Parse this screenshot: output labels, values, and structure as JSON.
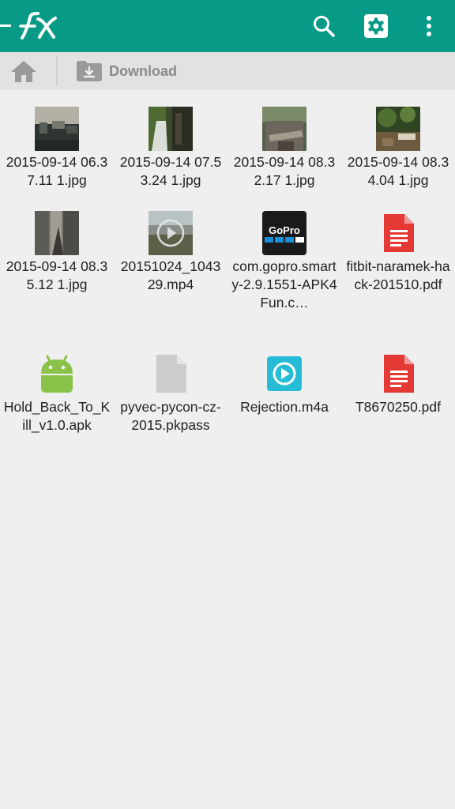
{
  "app": {
    "logo_text": "FX",
    "colors": {
      "appbar": "#079a87",
      "location_bar": "#e2e2e2",
      "background": "#efefef"
    },
    "actions": [
      {
        "name": "search",
        "icon": "search-icon"
      },
      {
        "name": "settings",
        "icon": "gear-icon"
      },
      {
        "name": "more",
        "icon": "more-vert-icon"
      }
    ]
  },
  "location": {
    "home_icon": "home-icon",
    "folder_icon": "download-folder-icon",
    "current_folder": "Download"
  },
  "files": [
    {
      "label": "2015-09-14 06.37.11 1.jpg",
      "type": "image"
    },
    {
      "label": "2015-09-14 07.53.24 1.jpg",
      "type": "image"
    },
    {
      "label": "2015-09-14 08.32.17 1.jpg",
      "type": "image"
    },
    {
      "label": "2015-09-14 08.34.04 1.jpg",
      "type": "image"
    },
    {
      "label": "2015-09-14 08.35.12 1.jpg",
      "type": "image"
    },
    {
      "label": "20151024_104329.mp4",
      "type": "video"
    },
    {
      "label": "com.gopro.smarty-2.9.1551-APK4Fun.c…",
      "type": "gopro-apk",
      "icon_text": "GoPro"
    },
    {
      "label": "fitbit-naramek-hack-201510.pdf",
      "type": "pdf"
    },
    {
      "label": "Hold_Back_To_Kill_v1.0.apk",
      "type": "apk"
    },
    {
      "label": "pyvec-pycon-cz-2015.pkpass",
      "type": "generic"
    },
    {
      "label": "Rejection.m4a",
      "type": "audio"
    },
    {
      "label": "T8670250.pdf",
      "type": "pdf"
    }
  ]
}
